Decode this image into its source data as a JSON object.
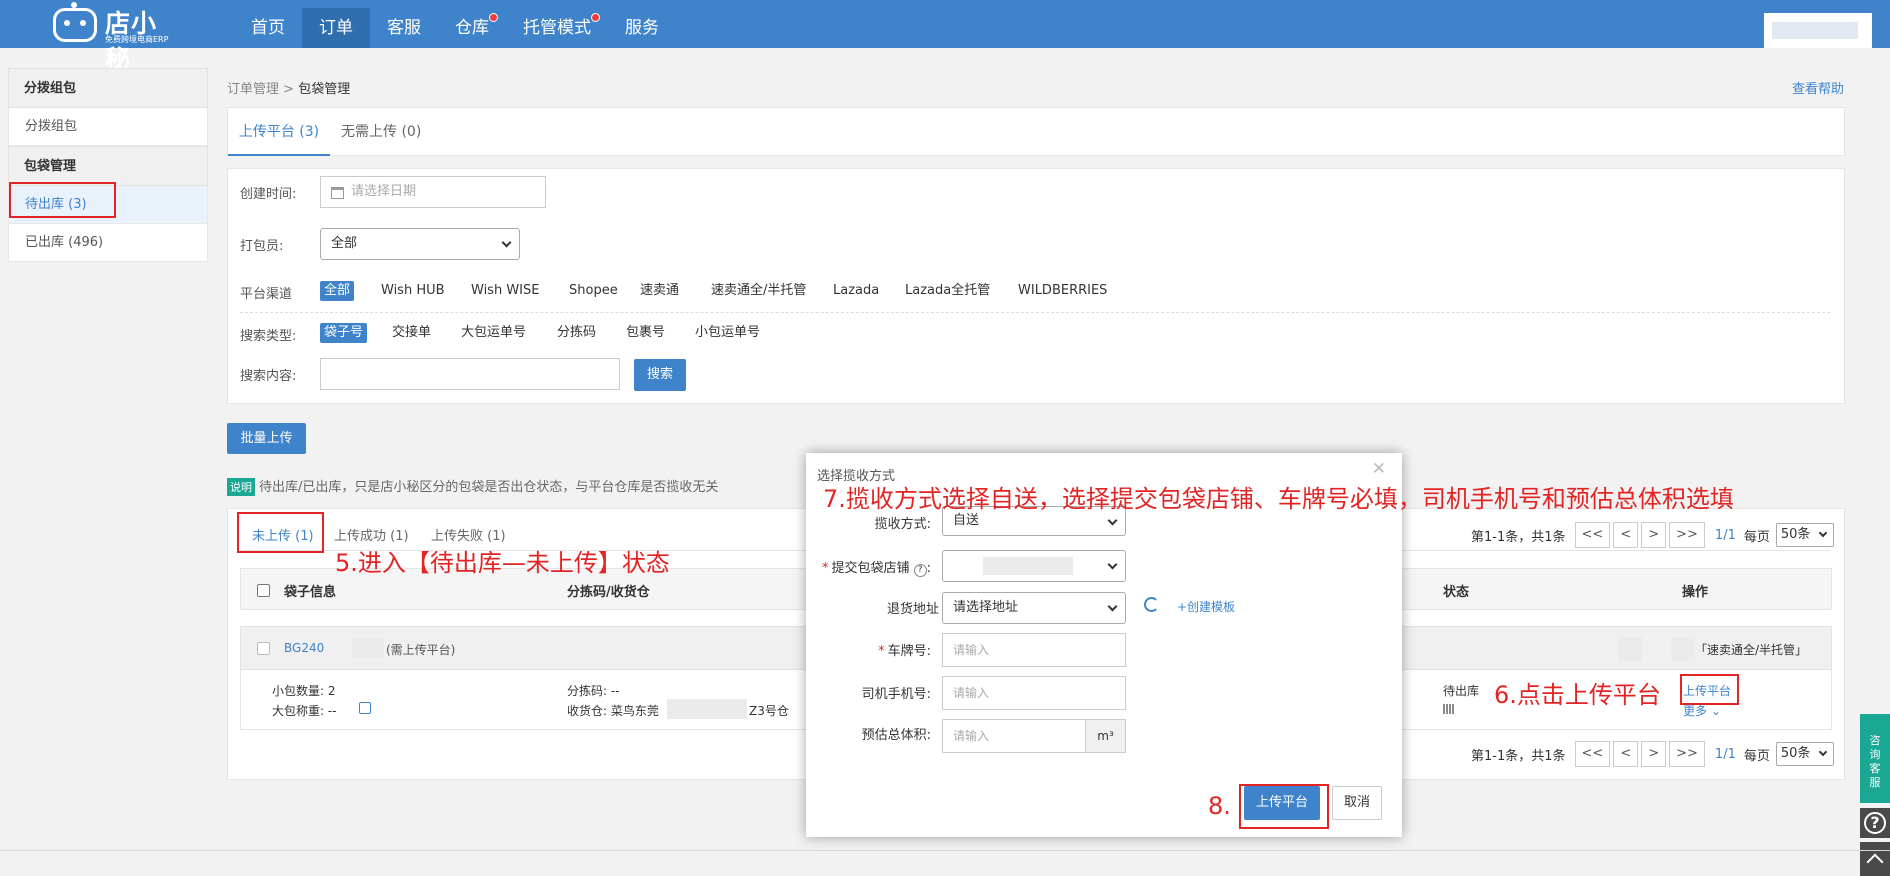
{
  "app": {
    "logo_name": "店小秘",
    "logo_sub": "免费跨境电商ERP"
  },
  "nav": [
    {
      "label": "首页",
      "active": false,
      "dot": false
    },
    {
      "label": "订单",
      "active": true,
      "dot": false
    },
    {
      "label": "客服",
      "active": false,
      "dot": false
    },
    {
      "label": "仓库",
      "active": false,
      "dot": true
    },
    {
      "label": "托管模式",
      "active": false,
      "dot": true
    },
    {
      "label": "服务",
      "active": false,
      "dot": false
    }
  ],
  "sidebar": {
    "group1": "分拨组包",
    "item1": "分拨组包",
    "group2": "包袋管理",
    "item2": "待出库 (3)",
    "item3": "已出库 (496)"
  },
  "breadcrumb": {
    "parent": "订单管理",
    "sep": ">",
    "current": "包袋管理"
  },
  "help_link": "查看帮助",
  "tabs": {
    "upload": "上传平台 (3)",
    "no_upload": "无需上传 (0)"
  },
  "filters": {
    "created_label": "创建时间:",
    "date_placeholder": "请选择日期",
    "packer_label": "打包员:",
    "packer_value": "全部",
    "channel_label": "平台渠道",
    "channels": [
      "全部",
      "Wish HUB",
      "Wish WISE",
      "Shopee",
      "速卖通",
      "速卖通全/半托管",
      "Lazada",
      "Lazada全托管",
      "WILDBERRIES"
    ],
    "search_type_label": "搜索类型:",
    "search_types": [
      "袋子号",
      "交接单",
      "大包运单号",
      "分拣码",
      "包裹号",
      "小包运单号"
    ],
    "search_content_label": "搜索内容:",
    "search_button": "搜索"
  },
  "batch_upload": "批量上传",
  "tip": {
    "tag": "说明",
    "text": "待出库/已出库，只是店小秘区分的包袋是否出仓状态，与平台仓库是否揽收无关"
  },
  "subtabs": [
    "未上传 (1)",
    "上传成功 (1)",
    "上传失败 (1)"
  ],
  "pagination": {
    "summary": "第1-1条，共1条",
    "first": "<<",
    "prev": "<",
    "next": ">",
    "last": ">>",
    "current": "1/1",
    "per_page_label": "每页",
    "per_page": "50条"
  },
  "table": {
    "headers": {
      "bag_info": "袋子信息",
      "sort_code": "分拣码/收货仓",
      "status": "状态",
      "action": "操作"
    },
    "row": {
      "bag_no": "BG240",
      "upload_note": "(需上传平台)",
      "platform_tag": "「速卖通全/半托管」",
      "small_qty_label": "小包数量:",
      "small_qty": "2",
      "weight_label": "大包称重:",
      "weight": "--",
      "sort_label": "分拣码:",
      "sort_value": "--",
      "wh_label": "收货仓:",
      "wh_prefix": "菜鸟东莞",
      "wh_suffix": "Z3号仓",
      "status": "待出库",
      "upload_action": "上传平台",
      "more": "更多"
    }
  },
  "modal": {
    "title": "选择揽收方式",
    "method_label": "揽收方式:",
    "method_value": "自送",
    "store_label": "提交包袋店铺",
    "return_label": "退货地址",
    "return_value": "请选择地址",
    "create_template": "+创建模板",
    "plate_label": "车牌号:",
    "plate_placeholder": "请输入",
    "phone_label": "司机手机号:",
    "phone_placeholder": "请输入",
    "volume_label": "预估总体积:",
    "volume_placeholder": "请输入",
    "volume_unit": "m³",
    "confirm": "上传平台",
    "cancel": "取消"
  },
  "annotations": {
    "a5": "5.进入【待出库—未上传】状态",
    "a6": "6.点击上传平台",
    "a7": "7.揽收方式选择自送，选择提交包袋店铺、车牌号必填，司机手机号和预估总体积选填",
    "a8": "8."
  },
  "right_bar": {
    "consult": "咨询客服",
    "help": "?"
  }
}
